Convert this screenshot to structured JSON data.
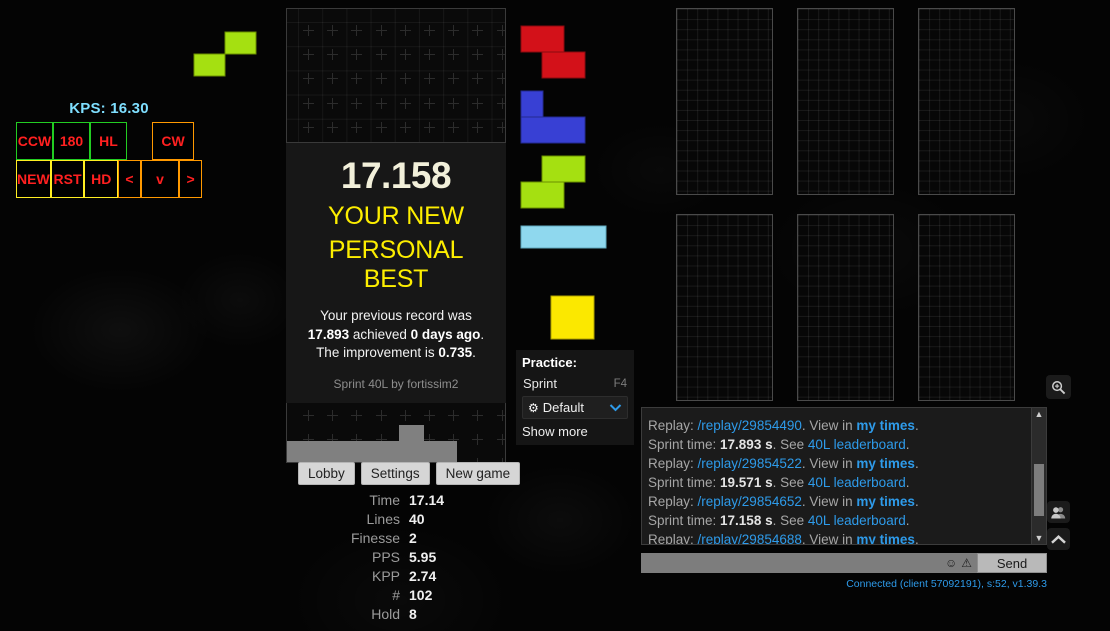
{
  "hud": {
    "kps_label": "KPS: 16.30",
    "keys_row1": [
      {
        "label": "CCW",
        "color": "green"
      },
      {
        "label": "180",
        "color": "green"
      },
      {
        "label": "HL",
        "color": "green"
      },
      {
        "label": "",
        "color": "gap"
      },
      {
        "label": "CW",
        "color": "orange"
      }
    ],
    "keys_row2": [
      {
        "label": "NEW",
        "color": "yellow"
      },
      {
        "label": "RST",
        "color": "yellow"
      },
      {
        "label": "HD",
        "color": "yellow"
      },
      {
        "label": "<",
        "color": "orange"
      },
      {
        "label": "v",
        "color": "orange"
      },
      {
        "label": ">",
        "color": "orange"
      }
    ]
  },
  "result": {
    "time": "17.158",
    "headline_line1": "YOUR NEW",
    "headline_line2": "PERSONAL BEST",
    "previous_record_prefix": "Your previous record was ",
    "previous_record_value": "17.893",
    "achieved_prefix": " achieved ",
    "achieved_value": "0 days ago",
    "improvement_prefix": ". The improvement is ",
    "improvement_value": "0.735",
    "improvement_suffix": ".",
    "mode_line": "Sprint 40L by fortissim2"
  },
  "practice": {
    "title": "Practice:",
    "mode_label": "Sprint",
    "mode_hotkey": "F4",
    "preset_label": "Default",
    "gear_icon": "⚙",
    "chevron_icon": "⌄",
    "show_more": "Show more"
  },
  "buttons": {
    "lobby": "Lobby",
    "settings": "Settings",
    "new_game": "New game"
  },
  "stats": [
    {
      "label": "Time",
      "value": "17.14"
    },
    {
      "label": "Lines",
      "value": "40"
    },
    {
      "label": "Finesse",
      "value": "2"
    },
    {
      "label": "PPS",
      "value": "5.95"
    },
    {
      "label": "KPP",
      "value": "2.74"
    },
    {
      "label": "#",
      "value": "102"
    },
    {
      "label": "Hold",
      "value": "8"
    }
  ],
  "queue": {
    "held_piece": "S",
    "pieces": [
      "Z",
      "J",
      "S",
      "I",
      "O"
    ],
    "colors": {
      "Z": "#d31119",
      "J": "#3840d4",
      "S": "#a5e011",
      "I": "#8fd8ee",
      "O": "#fbe800",
      "L": "#ff9000",
      "T": "#b000b0"
    }
  },
  "chat": {
    "clipped_top": "Sprint time: 19.571 s. See 40L leaderboard.",
    "lines": [
      {
        "type": "replay",
        "prefix": "Replay: ",
        "link": "/replay/29854490",
        "mid": ". View in ",
        "link2": "my times",
        "suffix": "."
      },
      {
        "type": "sprint",
        "prefix": "Sprint time: ",
        "value": "17.893 s",
        "mid": ". See ",
        "link2": "40L leaderboard",
        "suffix": "."
      },
      {
        "type": "replay",
        "prefix": "Replay: ",
        "link": "/replay/29854522",
        "mid": ". View in ",
        "link2": "my times",
        "suffix": "."
      },
      {
        "type": "sprint",
        "prefix": "Sprint time: ",
        "value": "19.571 s",
        "mid": ". See ",
        "link2": "40L leaderboard",
        "suffix": "."
      },
      {
        "type": "replay",
        "prefix": "Replay: ",
        "link": "/replay/29854652",
        "mid": ". View in ",
        "link2": "my times",
        "suffix": "."
      },
      {
        "type": "sprint",
        "prefix": "Sprint time: ",
        "value": "17.158 s",
        "mid": ". See ",
        "link2": "40L leaderboard",
        "suffix": "."
      },
      {
        "type": "replay",
        "prefix": "Replay: ",
        "link": "/replay/29854688",
        "mid": ". View in ",
        "link2": "my times",
        "suffix": "."
      }
    ],
    "input_value": "",
    "emoji_icon": "☺",
    "warn_icon": "⚠",
    "send_label": "Send",
    "status": "Connected (client 57092191), s:52, v1.39.3",
    "scroll_up": "▲",
    "scroll_down": "▼"
  },
  "icons": {
    "zoom_in": "zoom-in-icon",
    "people": "👥",
    "chevron_up": "⌃"
  },
  "opponents": {
    "count": 6,
    "columns": 10,
    "rows": 20
  },
  "colors": {
    "accent_blue": "#2e9bea",
    "pb_yellow": "#fdee00",
    "kps_cyan": "#7fdfff",
    "key_red": "#ff2020"
  }
}
